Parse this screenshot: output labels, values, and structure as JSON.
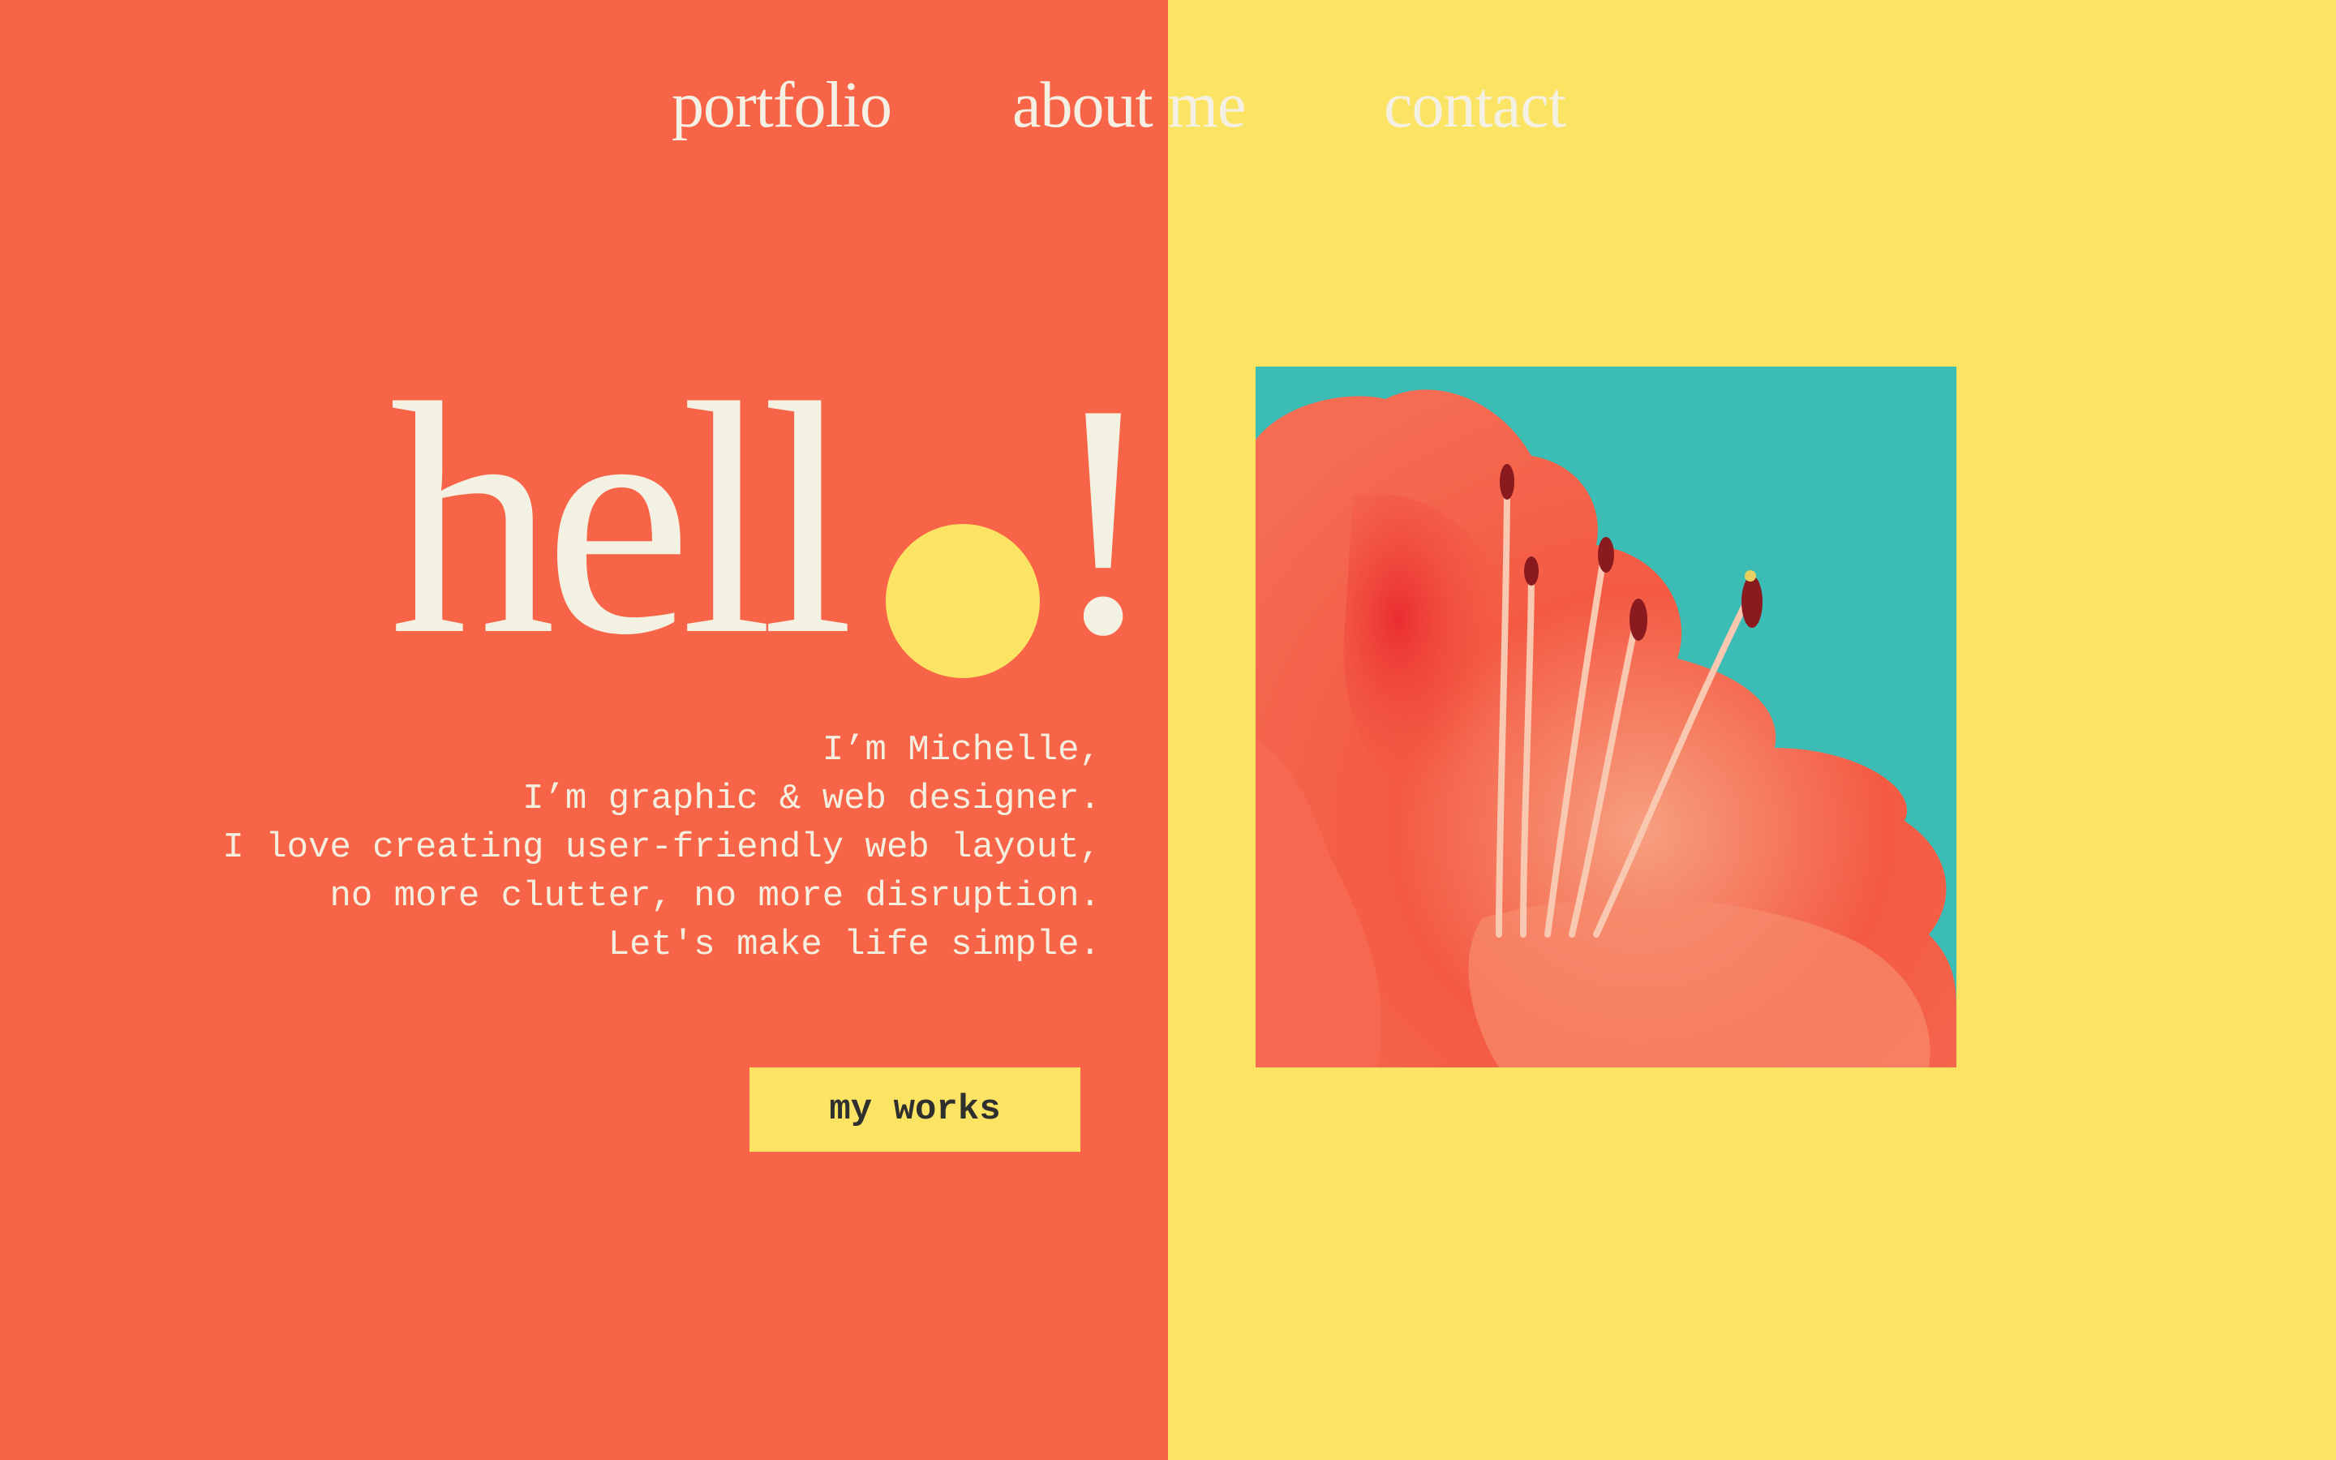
{
  "nav": {
    "items": [
      {
        "label": "portfolio"
      },
      {
        "label": "about me"
      },
      {
        "label": "contact"
      }
    ]
  },
  "hero": {
    "greeting": "hell",
    "greeting_end": "!"
  },
  "bio": {
    "lines": [
      "I’m Michelle,",
      "I’m graphic & web designer.",
      "I love creating user-friendly web layout,",
      "no more clutter, no more disruption.",
      "Let's make life simple."
    ]
  },
  "cta": {
    "label": "my works"
  },
  "colors": {
    "left_background": "#F86448",
    "right_background": "#FBE463",
    "text_light": "#F3F1E2",
    "accent_yellow": "#FBE463",
    "photo_sky": "#3BBDB6",
    "flower": "#F2553F"
  },
  "image": {
    "subject": "flower-photo"
  }
}
